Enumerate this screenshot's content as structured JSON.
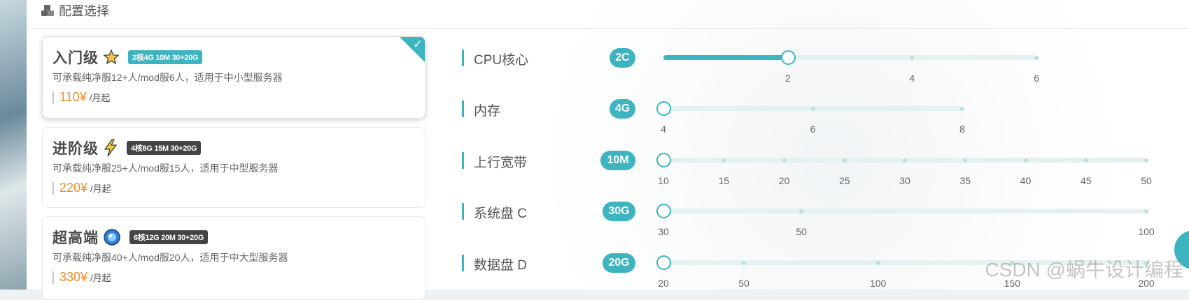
{
  "header": {
    "icon": "cubes-icon",
    "title": "配置选择"
  },
  "plans": [
    {
      "name": "入门级",
      "icon": "star-icon",
      "tag": "2核4G 10M 30+20G",
      "tag_color": "#3db4bf",
      "desc": "可承载纯净服12+人/mod服6人，适用于中小型服务器",
      "price": "110¥",
      "unit": "/月起",
      "selected": true
    },
    {
      "name": "进阶级",
      "icon": "lightning-icon",
      "tag": "4核8G 15M 30+20G",
      "tag_color": "#444444",
      "desc": "可承载纯净服25+人/mod服15人，适用于中型服务器",
      "price": "220¥",
      "unit": "/月起",
      "selected": false
    },
    {
      "name": "超高端",
      "icon": "gem-icon",
      "tag": "6核12G 20M 30+20G",
      "tag_color": "#444444",
      "desc": "可承载纯净服40+人/mod服20人，适用于中大型服务器",
      "price": "330¥",
      "unit": "/月起",
      "selected": false
    }
  ],
  "sliders": [
    {
      "label": "CPU核心",
      "badge": "2C",
      "min": 0,
      "max": 6,
      "value": 2,
      "marks": [
        "2",
        "4",
        "6"
      ]
    },
    {
      "label": "内存",
      "badge": "4G",
      "min": 4,
      "max": 8,
      "value": 4,
      "marks": [
        "4",
        "6",
        "8"
      ]
    },
    {
      "label": "上行宽带",
      "badge": "10M",
      "min": 10,
      "max": 50,
      "value": 10,
      "marks": [
        "10",
        "15",
        "20",
        "25",
        "30",
        "35",
        "40",
        "45",
        "50"
      ]
    },
    {
      "label": "系统盘 C",
      "badge": "30G",
      "min": 30,
      "max": 100,
      "value": 30,
      "marks": [
        "30",
        "50",
        "100"
      ]
    },
    {
      "label": "数据盘 D",
      "badge": "20G",
      "min": 20,
      "max": 200,
      "value": 20,
      "marks": [
        "20",
        "50",
        "100",
        "150",
        "200"
      ]
    }
  ],
  "watermark": "CSDN @蜗牛设计编程",
  "colors": {
    "accent": "#3db4bf",
    "price": "#f28c28"
  }
}
